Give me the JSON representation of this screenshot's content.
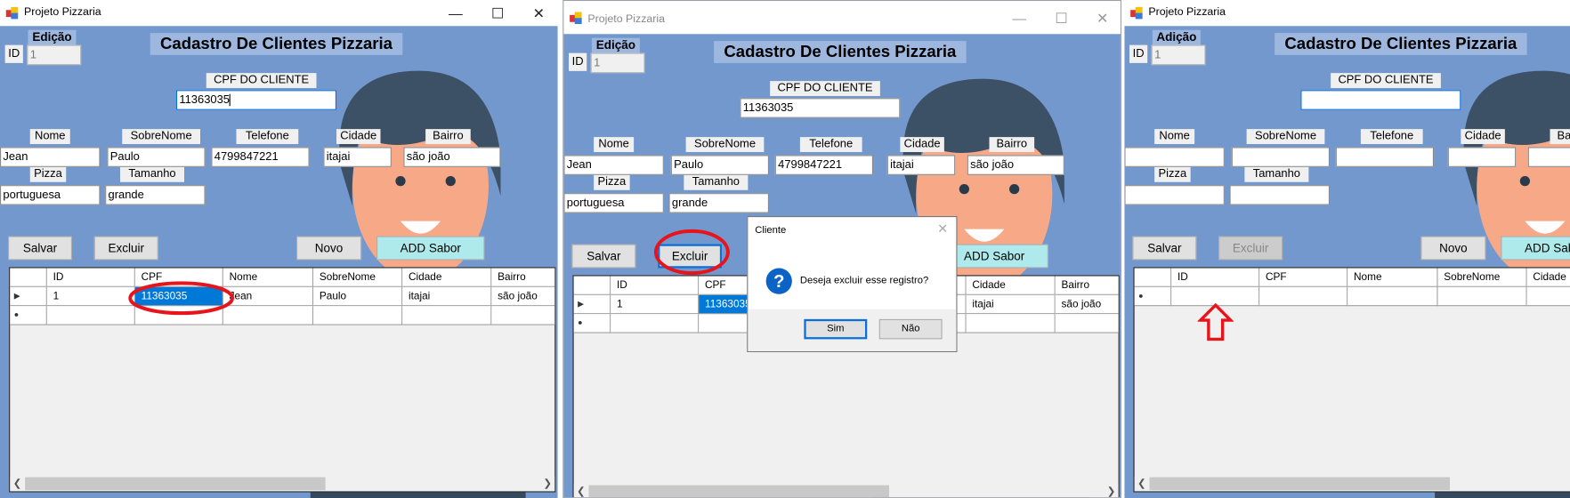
{
  "app_title": "Projeto Pizzaria",
  "banner": "Cadastro De Clientes Pizzaria",
  "labels": {
    "id": "ID",
    "cpf": "CPF DO CLIENTE",
    "nome": "Nome",
    "sobrenome": "SobreNome",
    "telefone": "Telefone",
    "cidade": "Cidade",
    "bairro": "Bairro",
    "pizza": "Pizza",
    "tamanho": "Tamanho"
  },
  "buttons": {
    "salvar": "Salvar",
    "excluir": "Excluir",
    "novo": "Novo",
    "add_sabor": "ADD Sabor"
  },
  "grid_columns": [
    "ID",
    "CPF",
    "Nome",
    "SobreNome",
    "Cidade",
    "Bairro"
  ],
  "windows": [
    {
      "mode": "Edição",
      "fields": {
        "id": "1",
        "cpf": "11363035",
        "nome": "Jean",
        "sobrenome": "Paulo",
        "telefone": "4799847221",
        "cidade": "itajai",
        "bairro": "são joão",
        "pizza": "portuguesa",
        "tamanho": "grande"
      },
      "excluir_enabled": true,
      "rows": [
        [
          "1",
          "11363035",
          "Jean",
          "Paulo",
          "itajai",
          "são joão"
        ]
      ],
      "selected_cell": "CPF"
    },
    {
      "mode": "Edição",
      "fields": {
        "id": "1",
        "cpf": "11363035",
        "nome": "Jean",
        "sobrenome": "Paulo",
        "telefone": "4799847221",
        "cidade": "itajai",
        "bairro": "são joão",
        "pizza": "portuguesa",
        "tamanho": "grande"
      },
      "excluir_enabled": true,
      "rows": [
        [
          "1",
          "11363035",
          "Jean",
          "Paulo",
          "itajai",
          "são joão"
        ]
      ],
      "selected_cell": "CPF",
      "dialog": {
        "title": "Cliente",
        "icon": "question-icon",
        "message": "Deseja excluir esse registro?",
        "yes": "Sim",
        "no": "Não"
      }
    },
    {
      "mode": "Adição",
      "fields": {
        "id": "1",
        "cpf": "",
        "nome": "",
        "sobrenome": "",
        "telefone": "",
        "cidade": "",
        "bairro": "",
        "pizza": "",
        "tamanho": ""
      },
      "excluir_enabled": false,
      "rows": []
    }
  ],
  "colors": {
    "form_bg": "#7398ce",
    "selection": "#0078d7",
    "add_button": "#aeeaeb",
    "annotation": "#e8141c"
  }
}
